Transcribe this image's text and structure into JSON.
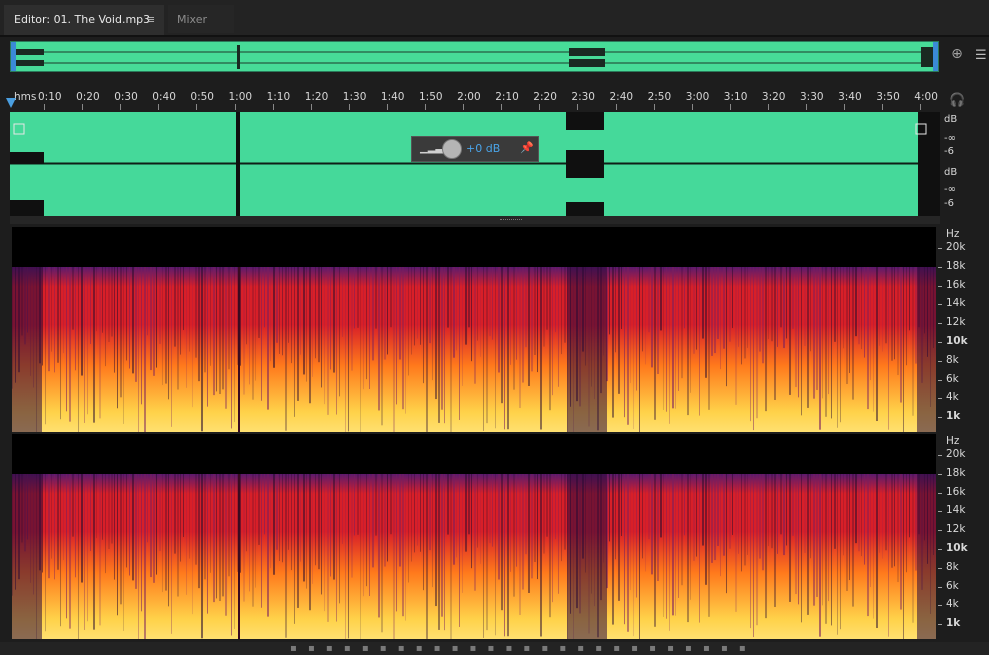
{
  "tabs": {
    "editor_label": "Editor: 01. The Void.mp3",
    "menu_icon": "hamburger-menu-icon",
    "mixer_label": "Mixer"
  },
  "ruler": {
    "labels": [
      "hms",
      "0:10",
      "0:20",
      "0:30",
      "0:40",
      "0:50",
      "1:00",
      "1:10",
      "1:20",
      "1:30",
      "1:40",
      "1:50",
      "2:00",
      "2:10",
      "2:20",
      "2:30",
      "2:40",
      "2:50",
      "3:00",
      "3:10",
      "3:20",
      "3:30",
      "3:40",
      "3:50",
      "4:00"
    ]
  },
  "waveform": {
    "color": "#45d99a",
    "channels": [
      {
        "db_label": "dB",
        "neg_inf": "-∞",
        "minus6": "-6"
      },
      {
        "db_label": "dB",
        "neg_inf": "-∞",
        "minus6": "-6"
      }
    ]
  },
  "volume_hud": {
    "value": "+0 dB",
    "icons": [
      "level-bars-icon",
      "volume-knob-icon",
      "pin-icon"
    ]
  },
  "spectral": {
    "hz_unit": "Hz",
    "freq_labels": [
      "20k",
      "18k",
      "16k",
      "14k",
      "12k",
      "10k",
      "8k",
      "6k",
      "4k",
      "1k"
    ],
    "colors": {
      "low": "#ffd24a",
      "mid": "#ff7a1c",
      "high": "#d81f28",
      "top": "#5a1a6e"
    }
  },
  "icons": {
    "zoom": "zoom-magnifier-icon",
    "headphones": "headphones-icon",
    "side_panel": "list-panel-icon"
  }
}
